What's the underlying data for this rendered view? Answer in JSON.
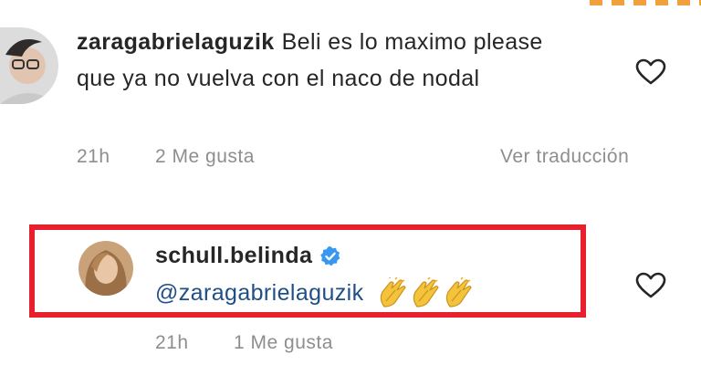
{
  "comments": [
    {
      "username": "zaragabrielaguzik",
      "text": "Beli es lo maximo please que ya no vuelva con el naco de nodal",
      "time": "21h",
      "likes": "2 Me gusta",
      "translate_label": "Ver traducción"
    },
    {
      "username": "schull.belinda",
      "mention": "@zaragabrielaguzik",
      "emoji": "👏👏👏",
      "time": "21h",
      "likes": "1 Me gusta"
    }
  ],
  "colors": {
    "highlight": "#e8202e",
    "mention": "#1f4f86",
    "verified": "#3897f0",
    "meta": "#8e8e8e"
  },
  "icons": [
    "heart-icon",
    "verified-badge-icon",
    "clapping-hands-icon"
  ]
}
